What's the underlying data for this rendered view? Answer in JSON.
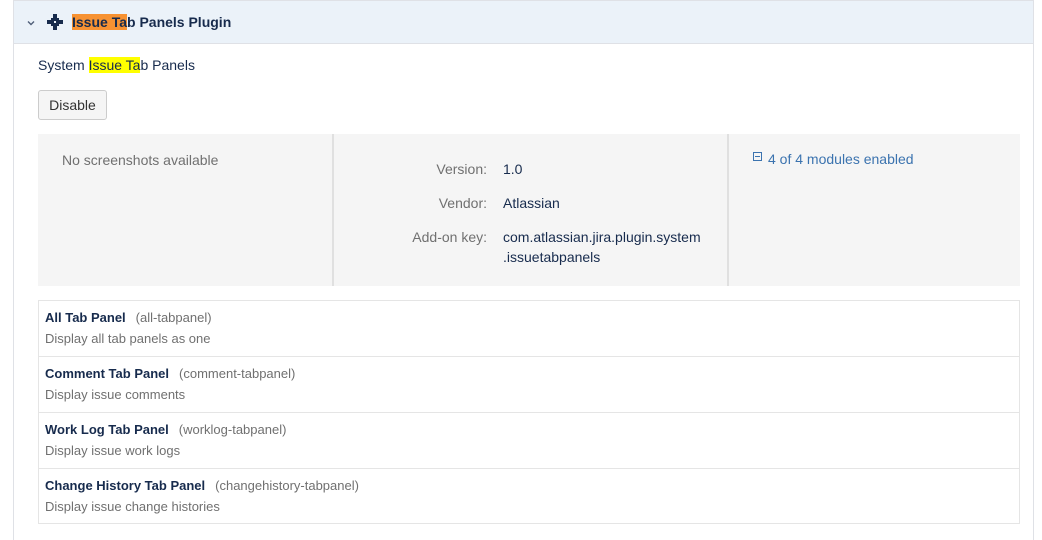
{
  "plugin": {
    "title_highlight": "Issue Ta",
    "title_rest": "b Panels Plugin",
    "desc_prefix": "System ",
    "desc_highlight": "Issue Ta",
    "desc_rest": "b Panels",
    "disable_label": "Disable"
  },
  "info": {
    "no_screenshots": "No screenshots available",
    "version_label": "Version:",
    "version_value": "1.0",
    "vendor_label": "Vendor:",
    "vendor_value": "Atlassian",
    "key_label": "Add-on key:",
    "key_value_line1": "com.atlassian.jira.plugin.system",
    "key_value_line2": ".issuetabpanels",
    "modules_link": "4 of 4 modules enabled"
  },
  "modules": [
    {
      "name": "All Tab Panel",
      "key": "(all-tabpanel)",
      "desc": "Display all tab panels as one"
    },
    {
      "name": "Comment Tab Panel",
      "key": "(comment-tabpanel)",
      "desc": "Display issue comments"
    },
    {
      "name": "Work Log Tab Panel",
      "key": "(worklog-tabpanel)",
      "desc": "Display issue work logs"
    },
    {
      "name": "Change History Tab Panel",
      "key": "(changehistory-tabpanel)",
      "desc": "Display issue change histories"
    }
  ],
  "colors": {
    "header_bg": "#ebf2f9",
    "highlight_orange": "#f79232",
    "highlight_yellow": "#ffff00",
    "link": "#3b73af"
  },
  "icons": {
    "expand": "chevron-down-icon",
    "plugin": "plugin-icon",
    "modules_toggle": "collapse-square-icon"
  }
}
